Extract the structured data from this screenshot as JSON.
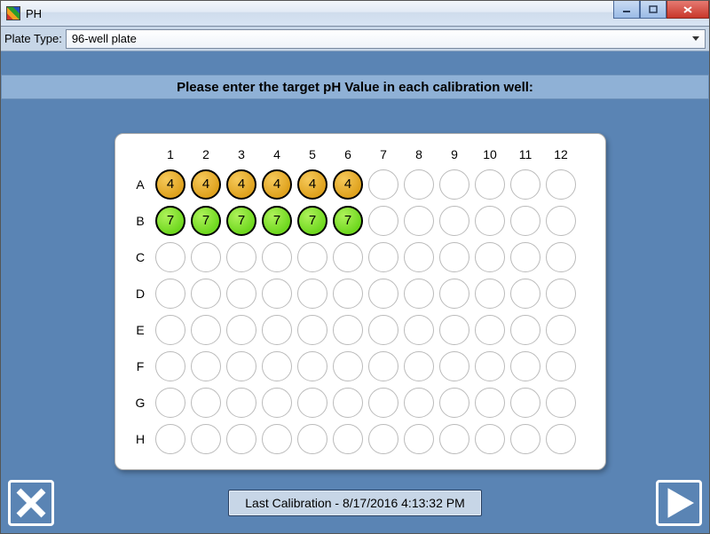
{
  "window": {
    "title": "PH"
  },
  "dropdown": {
    "label": "Plate Type:",
    "selected": "96-well plate"
  },
  "instruction": "Please enter the target pH Value in each calibration well:",
  "plate": {
    "columns": [
      "1",
      "2",
      "3",
      "4",
      "5",
      "6",
      "7",
      "8",
      "9",
      "10",
      "11",
      "12"
    ],
    "rows": [
      "A",
      "B",
      "C",
      "D",
      "E",
      "F",
      "G",
      "H"
    ],
    "wells": {
      "A1": {
        "value": "4",
        "color": "orange"
      },
      "A2": {
        "value": "4",
        "color": "orange"
      },
      "A3": {
        "value": "4",
        "color": "orange"
      },
      "A4": {
        "value": "4",
        "color": "orange"
      },
      "A5": {
        "value": "4",
        "color": "orange"
      },
      "A6": {
        "value": "4",
        "color": "orange"
      },
      "B1": {
        "value": "7",
        "color": "green"
      },
      "B2": {
        "value": "7",
        "color": "green"
      },
      "B3": {
        "value": "7",
        "color": "green"
      },
      "B4": {
        "value": "7",
        "color": "green"
      },
      "B5": {
        "value": "7",
        "color": "green"
      },
      "B6": {
        "value": "7",
        "color": "green"
      }
    }
  },
  "footer": {
    "last_calibration_label": "Last Calibration - ",
    "last_calibration_value": "8/17/2016 4:13:32 PM"
  }
}
